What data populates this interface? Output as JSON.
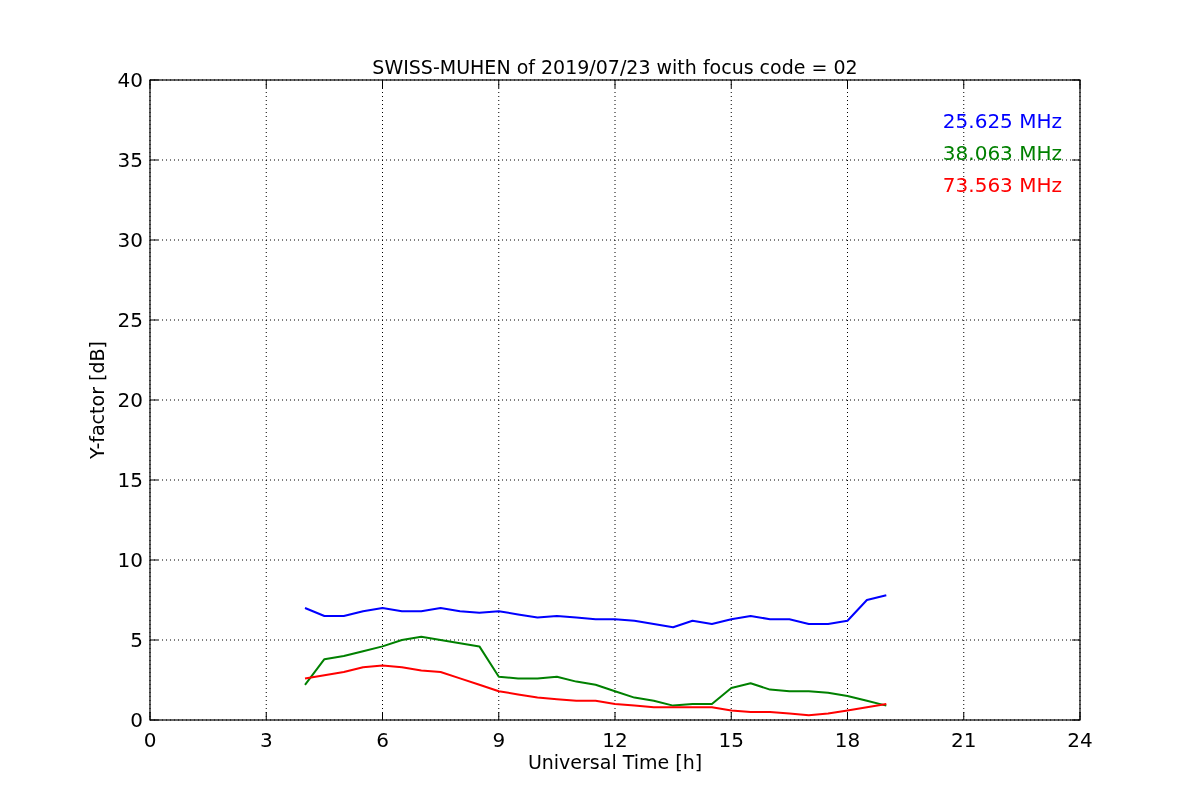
{
  "chart_data": {
    "type": "line",
    "title": "SWISS-MUHEN of 2019/07/23 with focus code = 02",
    "xlabel": "Universal Time [h]",
    "ylabel": "Y-factor [dB]",
    "x": [
      4,
      4.5,
      5,
      5.5,
      6,
      6.5,
      7,
      7.5,
      8,
      8.5,
      9,
      9.5,
      10,
      10.5,
      11,
      11.5,
      12,
      12.5,
      13,
      13.5,
      14,
      14.5,
      15,
      15.5,
      16,
      16.5,
      17,
      17.5,
      18,
      18.5,
      19
    ],
    "series": [
      {
        "name": "25.625 MHz",
        "color": "#0000ff",
        "values": [
          7,
          6.5,
          6.5,
          6.8,
          7,
          6.8,
          6.8,
          7,
          6.8,
          6.7,
          6.8,
          6.6,
          6.4,
          6.5,
          6.4,
          6.3,
          6.3,
          6.2,
          6.0,
          5.8,
          6.2,
          6.0,
          6.3,
          6.5,
          6.3,
          6.3,
          6.0,
          6.0,
          6.2,
          7.5,
          7.8
        ]
      },
      {
        "name": "38.063 MHz",
        "color": "#008000",
        "values": [
          2.2,
          3.8,
          4.0,
          4.3,
          4.6,
          5.0,
          5.2,
          5.0,
          4.8,
          4.6,
          2.7,
          2.6,
          2.6,
          2.7,
          2.4,
          2.2,
          1.8,
          1.4,
          1.2,
          0.9,
          1.0,
          1.0,
          2.0,
          2.3,
          1.9,
          1.8,
          1.8,
          1.7,
          1.5,
          1.2,
          0.9
        ]
      },
      {
        "name": "73.563 MHz",
        "color": "#ff0000",
        "values": [
          2.6,
          2.8,
          3.0,
          3.3,
          3.4,
          3.3,
          3.1,
          3.0,
          2.6,
          2.2,
          1.8,
          1.6,
          1.4,
          1.3,
          1.2,
          1.2,
          1.0,
          0.9,
          0.8,
          0.8,
          0.8,
          0.8,
          0.6,
          0.5,
          0.5,
          0.4,
          0.3,
          0.4,
          0.6,
          0.8,
          1.0
        ]
      }
    ],
    "grid": true,
    "xlim": [
      0,
      24
    ],
    "ylim": [
      0,
      40
    ],
    "xticks": [
      0,
      3,
      6,
      9,
      12,
      15,
      18,
      21,
      24
    ],
    "yticks": [
      0,
      5,
      10,
      15,
      20,
      25,
      30,
      35,
      40
    ]
  }
}
